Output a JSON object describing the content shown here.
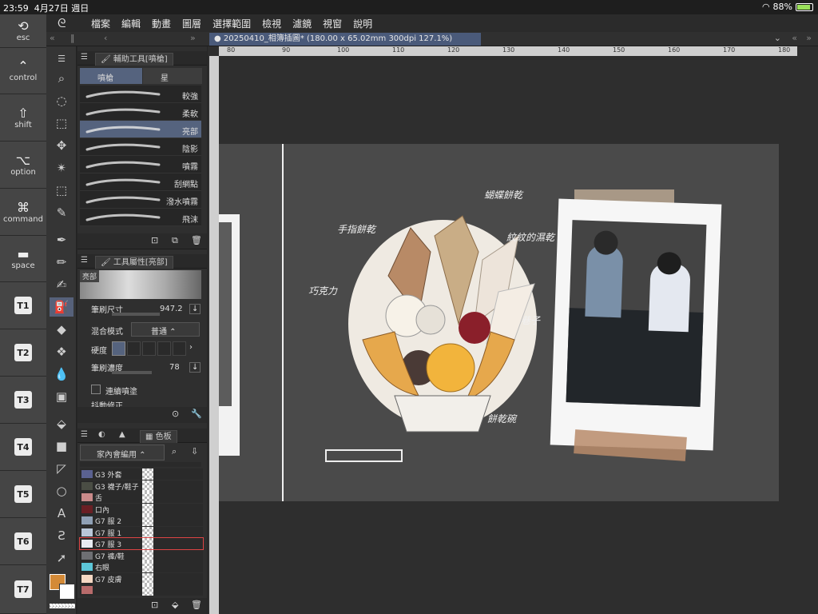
{
  "status": {
    "time": "23:59",
    "date": "4月27日 週日",
    "battery": "88%"
  },
  "keys": {
    "esc": "esc",
    "control": "control",
    "shift": "shift",
    "option": "option",
    "command": "command",
    "space": "space"
  },
  "tkeys": [
    "T1",
    "T2",
    "T3",
    "T4",
    "T5",
    "T6",
    "T7"
  ],
  "menu": [
    "檔案",
    "編輯",
    "動畫",
    "圖層",
    "選擇範圍",
    "檢視",
    "濾鏡",
    "視窗",
    "說明"
  ],
  "document": {
    "tab": "20250410_相簿插圖* (180.00 x 65.02mm 300dpi 127.1%)"
  },
  "subtool": {
    "header": "輔助工具[噴槍]",
    "tab_airbrush": "噴槍",
    "tab_star": "星",
    "brushes": [
      "較強",
      "柔軟",
      "亮部",
      "陰影",
      "噴霧",
      "刮網點",
      "潑水噴霧",
      "飛沫"
    ],
    "selected_index": 2
  },
  "toolprop": {
    "header": "工具屬性[亮部]",
    "preview_label": "亮部",
    "brush_size_label": "筆刷尺寸",
    "brush_size": "947.2",
    "blend_label": "混合模式",
    "blend_value": "普通",
    "hardness_label": "硬度",
    "density_label": "筆刷濃度",
    "density": "78",
    "continuous_label": "連續噴塗",
    "next_label": "抖動修正"
  },
  "palette": {
    "header": "色板",
    "set": "家內會編用",
    "swatches": [
      {
        "name": "G3 外套",
        "color": "#5a6190"
      },
      {
        "name": "G3 襪子/鞋子",
        "color": "#4a4d44"
      },
      {
        "name": "舌",
        "color": "#c98a8a"
      },
      {
        "name": "口內",
        "color": "#6a1f24"
      },
      {
        "name": "G7 服 2",
        "color": "#8fa0b5"
      },
      {
        "name": "G7 服 1",
        "color": "#b9c7d8"
      },
      {
        "name": "G7 服 3",
        "color": "#e7ecf2"
      },
      {
        "name": "G7 褲/鞋",
        "color": "#6e6f73"
      },
      {
        "name": "右眼",
        "color": "#5cc6d8"
      },
      {
        "name": "G7 皮膚",
        "color": "#f6d8c4"
      },
      {
        "name": "",
        "color": "#b86b6b"
      }
    ],
    "selected_index": 6
  },
  "colors": {
    "main": "#d48a37",
    "sub": "#ffffff",
    "accent": "#55637e"
  },
  "canvas": {
    "ruler_ticks": [
      "80",
      "90",
      "100",
      "110",
      "120",
      "130",
      "140",
      "150",
      "160",
      "170",
      "180"
    ],
    "notes": [
      "蝴蝶餅乾",
      "手指餅乾",
      "紋紋的濕乾",
      "巧克力",
      "餅乾碗",
      "巷子"
    ]
  }
}
